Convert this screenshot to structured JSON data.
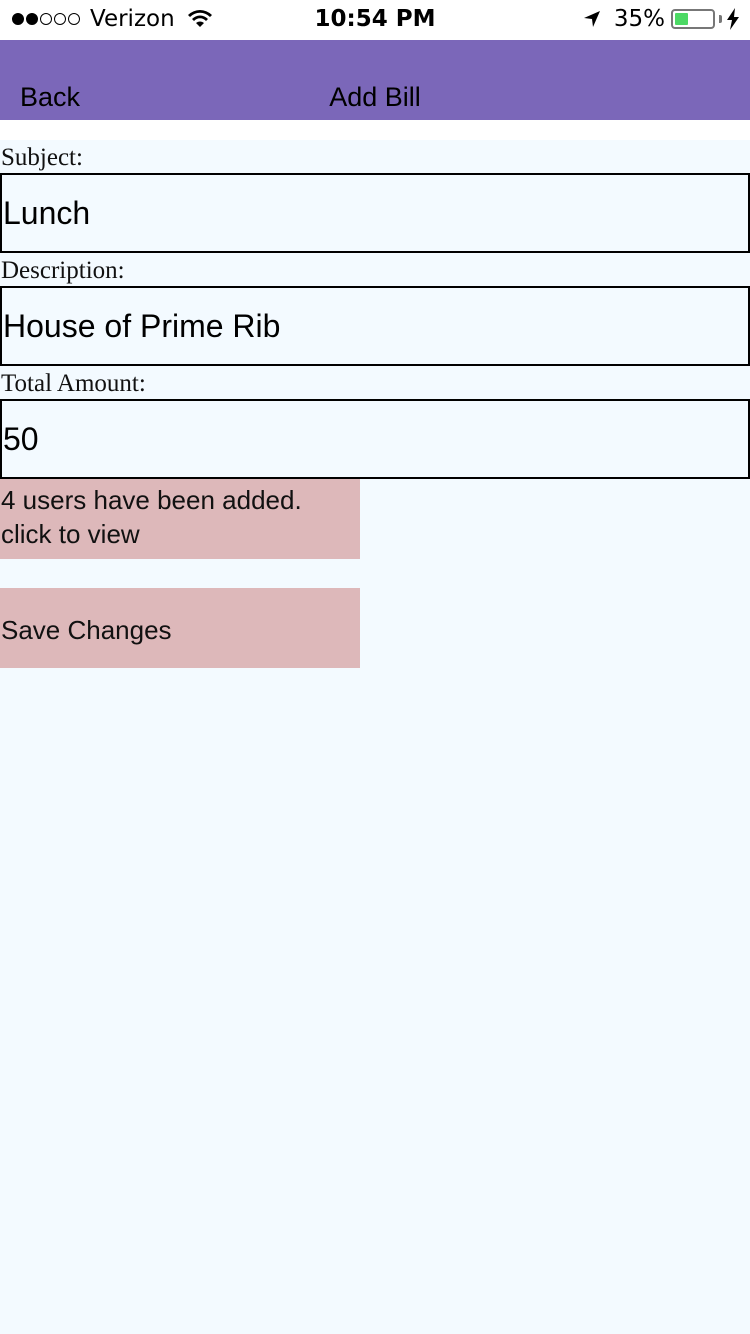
{
  "status_bar": {
    "carrier": "Verizon",
    "signal_dots_filled": 2,
    "signal_dots_total": 5,
    "time": "10:54 PM",
    "battery_percent_label": "35%",
    "battery_level": 0.35,
    "icons": [
      "wifi-icon",
      "location-arrow-icon",
      "battery-icon",
      "charging-bolt-icon"
    ]
  },
  "nav": {
    "back_label": "Back",
    "title": "Add Bill",
    "color": "#7b67b9"
  },
  "form": {
    "subject_label": "Subject:",
    "subject_value": "Lunch",
    "description_label": "Description:",
    "description_value": "House of Prime Rib",
    "amount_label": "Total Amount:",
    "amount_value": "50"
  },
  "users": {
    "line1": "4 users have been added.",
    "line2": "click to view"
  },
  "save_label": "Save Changes",
  "colors": {
    "background": "#f3faff",
    "button_bg": "#ddb8ba"
  }
}
